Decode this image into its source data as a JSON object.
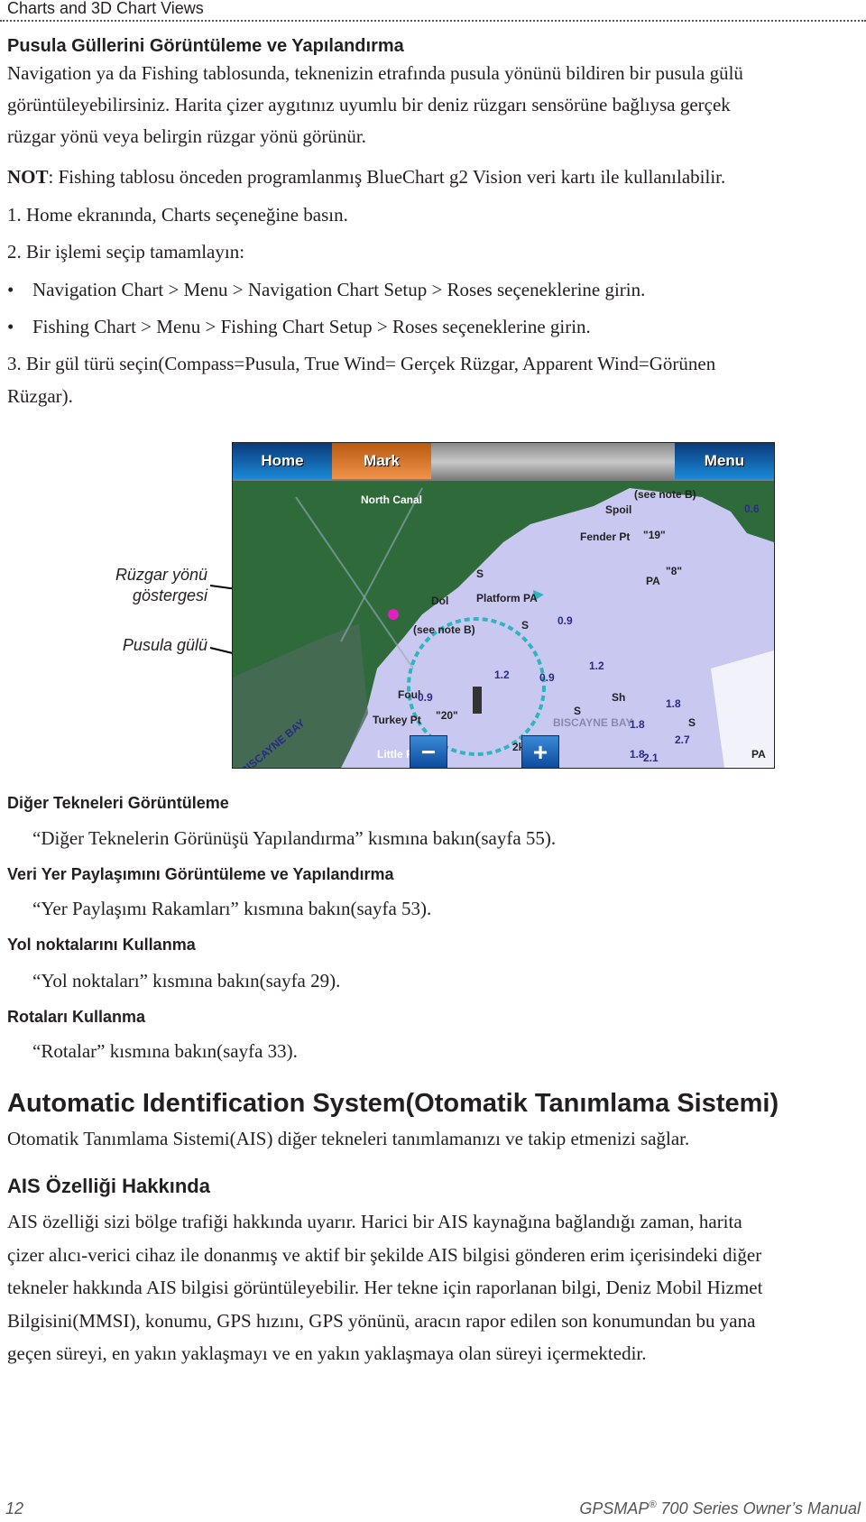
{
  "header": {
    "section": "Charts and 3D Chart Views"
  },
  "compass": {
    "title": "Pusula Güllerini Görüntüleme ve Yapılandırma",
    "intro": [
      "Navigation ya da Fishing tablosunda, teknenizin etrafında pusula yönünü bildiren bir pusula gülü",
      "görüntüleyebilirsiniz. Harita çizer aygıtınız uyumlu bir deniz rüzgarı sensörüne bağlıysa gerçek",
      "rüzgar yönü veya belirgin rüzgar yönü görünür."
    ],
    "note_label": "NOT",
    "note_text": ": Fishing tablosu önceden programlanmış BlueChart g2 Vision veri kartı ile kullanılabilir.",
    "step1": "1. Home ekranında, Charts seçeneğine basın.",
    "step2": "2. Bir işlemi seçip tamamlayın:",
    "bullets": [
      "Navigation Chart > Menu > Navigation Chart Setup > Roses seçeneklerine girin.",
      "Fishing Chart > Menu > Fishing Chart Setup > Roses seçeneklerine girin."
    ],
    "step3": [
      "3. Bir gül türü seçin(Compass=Pusula, True Wind= Gerçek Rüzgar, Apparent Wind=Görünen",
      "Rüzgar)."
    ]
  },
  "figure": {
    "callouts": {
      "wind_line1": "Rüzgar yönü",
      "wind_line2": "göstergesi",
      "rose": "Pusula gülü"
    },
    "buttons": {
      "home": "Home",
      "mark": "Mark",
      "menu": "Menu",
      "zoom_out": "−",
      "zoom_in": "+"
    },
    "map_labels": {
      "north_canal": "North Canal",
      "spoil": "Spoil",
      "see_note": "(see note B)",
      "fender": "Fender Pt",
      "dol": "Dol",
      "platform": "Platform PA",
      "see_note2": "(see note B)",
      "foul": "Foul",
      "turkey": "Turkey Pt",
      "little_river": "Little River",
      "biscayne": "BISCAYNE BAY",
      "pa1": "PA",
      "pa2": "PA",
      "scale": "2km",
      "d1": "0.6",
      "d2": "0.9",
      "d3": "1.2",
      "d4": "0.9",
      "d5": "1.2",
      "d6": "0.9",
      "d7": "1.8",
      "d8": "2.7",
      "d9": "1.8",
      "d10": "2.1",
      "d11": "1.8",
      "s1": "S",
      "s2": "S",
      "s3": "S",
      "s4": "S",
      "sh": "Sh",
      "n19": "\"19\"",
      "n8": "\"8\"",
      "n20": "\"20\""
    },
    "colors": {
      "water": "#c9c8f0",
      "land": "#2f6b3a",
      "rose": "#2fb5c0"
    }
  },
  "sections": [
    {
      "title": "Diğer Tekneleri Görüntüleme",
      "text": "“Diğer Teknelerin Görünüşü Yapılandırma” kısmına bakın(sayfa 55)."
    },
    {
      "title": "Veri Yer Paylaşımını Görüntüleme ve Yapılandırma",
      "text": "“Yer Paylaşımı Rakamları” kısmına bakın(sayfa 53)."
    },
    {
      "title": "Yol noktalarını Kullanma",
      "text": "“Yol noktaları” kısmına bakın(sayfa 29)."
    },
    {
      "title": "Rotaları Kullanma",
      "text": "“Rotalar” kısmına bakın(sayfa 33)."
    }
  ],
  "ais": {
    "title": "Automatic Identification System(Otomatik Tanımlama Sistemi)",
    "intro": "Otomatik Tanımlama Sistemi(AIS) diğer tekneleri tanımlamanızı ve takip etmenizi sağlar.",
    "sub_title": "AIS Özelliği Hakkında",
    "body": [
      "AIS özelliği sizi bölge trafiği hakkında uyarır. Harici bir AIS kaynağına bağlandığı zaman, harita",
      "çizer alıcı-verici cihaz ile donanmış ve aktif bir şekilde AIS bilgisi gönderen erim içerisindeki diğer",
      "tekneler hakkında AIS bilgisi görüntüleyebilir. Her tekne için raporlanan bilgi, Deniz Mobil Hizmet",
      "Bilgisini(MMSI), konumu, GPS hızını, GPS yönünü, aracın rapor edilen son konumundan bu yana",
      "geçen süreyi, en yakın yaklaşmayı ve en yakın yaklaşmaya olan süreyi içermektedir."
    ]
  },
  "footer": {
    "page": "12",
    "manual": "GPSMAP",
    "reg": "®",
    "manual_rest": " 700 Series Owner’s Manual"
  }
}
